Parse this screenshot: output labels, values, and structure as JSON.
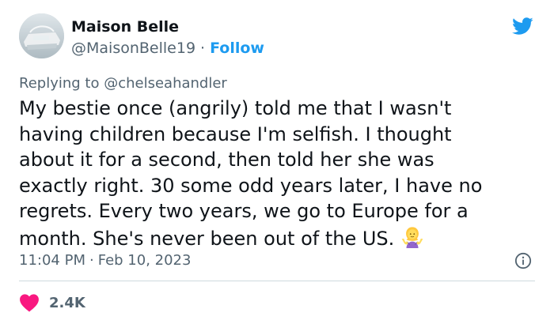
{
  "author": {
    "name": "Maison Belle",
    "handle": "@MaisonBelle19",
    "separator": "·",
    "follow_label": "Follow"
  },
  "reply": {
    "prefix": "Replying to",
    "handle": "@chelseahandler"
  },
  "tweet": {
    "lines": [
      "My bestie once (angrily) told me that I wasn't",
      "having children because I'm selfish. I thought",
      "about it for a second, then told her she was",
      "exactly right. 30 some odd years later, I have no",
      "regrets. Every two years, we go to Europe for a",
      "month. She's never been out of the US."
    ],
    "emoji": "person-shrugging-emoji"
  },
  "meta": {
    "time": "11:04 PM",
    "separator": "·",
    "date": "Feb 10, 2023"
  },
  "engagement": {
    "likes": "2.4K"
  },
  "icons": {
    "platform": "twitter-bird-icon",
    "info": "info-icon",
    "like": "heart-icon"
  },
  "colors": {
    "link": "#1d9bf0",
    "heart": "#f91880",
    "secondary_text": "#536471",
    "primary_text": "#0f1419"
  }
}
